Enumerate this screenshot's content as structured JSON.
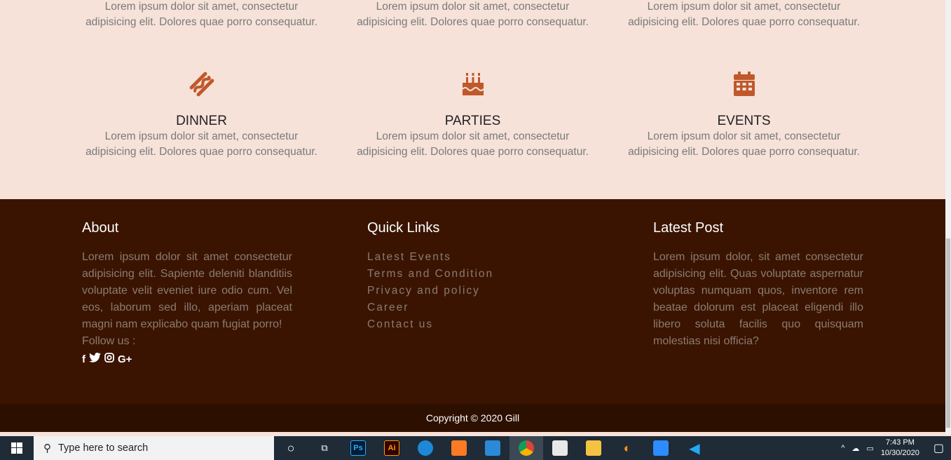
{
  "services_top": [
    {
      "text": "Lorem ipsum dolor sit amet, consectetur adipisicing elit. Dolores quae porro consequatur."
    },
    {
      "text": "Lorem ipsum dolor sit amet, consectetur adipisicing elit. Dolores quae porro consequatur."
    },
    {
      "text": "Lorem ipsum dolor sit amet, consectetur adipisicing elit. Dolores quae porro consequatur."
    }
  ],
  "services": [
    {
      "icon": "hotdog-icon",
      "title": "DINNER",
      "text": "Lorem ipsum dolor sit amet, consectetur adipisicing elit. Dolores quae porro consequatur."
    },
    {
      "icon": "birthday-cake-icon",
      "title": "PARTIES",
      "text": "Lorem ipsum dolor sit amet, consectetur adipisicing elit. Dolores quae porro consequatur."
    },
    {
      "icon": "calendar-icon",
      "title": "EVENTS",
      "text": "Lorem ipsum dolor sit amet, consectetur adipisicing elit. Dolores quae porro consequatur."
    }
  ],
  "colors": {
    "accent": "#c0582a",
    "footer": "#3a1400",
    "bottom": "#2d0f00",
    "bg": "#f6e2d9"
  },
  "footer": {
    "about": {
      "title": "About",
      "text": "Lorem ipsum dolor sit amet consectetur adipisicing elit. Sapiente deleniti blanditiis voluptate velit eveniet iure odio cum. Vel eos, laborum sed illo, aperiam placeat magni nam explicabo quam fugiat porro!",
      "follow": "Follow us :",
      "social": [
        "f",
        "t",
        "ig",
        "G+"
      ]
    },
    "links": {
      "title": "Quick Links",
      "items": [
        "Latest Events",
        "Terms and Condition",
        "Privacy and policy",
        "Career",
        "Contact us"
      ]
    },
    "post": {
      "title": "Latest Post",
      "text": "Lorem ipsum dolor, sit amet consectetur adipisicing elit. Quas voluptate aspernatur voluptas numquam quos, inventore rem beatae dolorum est placeat eligendi illo libero soluta facilis quo quisquam molestias nisi officia?"
    }
  },
  "copyright": "Copyright © 2020 Gill",
  "taskbar": {
    "search_placeholder": "Type here to search",
    "apps": [
      "Ps",
      "Ai"
    ],
    "time": "7:43 PM",
    "date": "10/30/2020"
  }
}
